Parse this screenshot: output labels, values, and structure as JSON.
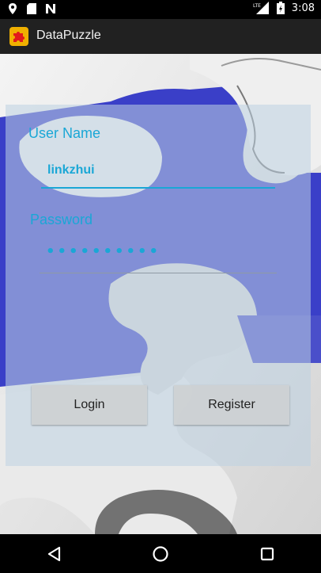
{
  "status_bar": {
    "time": "3:08",
    "network_label": "LTE"
  },
  "app_bar": {
    "title": "DataPuzzle",
    "icon_color": "#f0b000"
  },
  "login_form": {
    "username_label": "User Name",
    "username_value": "linkzhui",
    "password_label": "Password",
    "password_mask": "••••••••••",
    "login_label": "Login",
    "register_label": "Register"
  },
  "theme": {
    "accent": "#1aa7d6",
    "puzzle_blue": "#3a3fc8"
  }
}
